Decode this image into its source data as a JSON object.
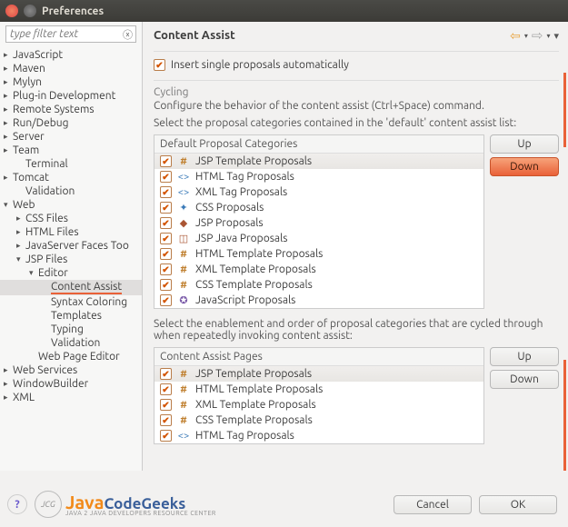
{
  "window": {
    "title": "Preferences"
  },
  "filter": {
    "placeholder": "type filter text"
  },
  "tree": [
    {
      "label": "JavaScript",
      "exp": "▸",
      "ind": 0
    },
    {
      "label": "Maven",
      "exp": "▸",
      "ind": 0
    },
    {
      "label": "Mylyn",
      "exp": "▸",
      "ind": 0
    },
    {
      "label": "Plug-in Development",
      "exp": "▸",
      "ind": 0
    },
    {
      "label": "Remote Systems",
      "exp": "▸",
      "ind": 0
    },
    {
      "label": "Run/Debug",
      "exp": "▸",
      "ind": 0
    },
    {
      "label": "Server",
      "exp": "▸",
      "ind": 0
    },
    {
      "label": "Team",
      "exp": "▸",
      "ind": 0
    },
    {
      "label": "Terminal",
      "exp": "",
      "ind": 1
    },
    {
      "label": "Tomcat",
      "exp": "▸",
      "ind": 0
    },
    {
      "label": "Validation",
      "exp": "",
      "ind": 1
    },
    {
      "label": "Web",
      "exp": "▾",
      "ind": 0
    },
    {
      "label": "CSS Files",
      "exp": "▸",
      "ind": 1
    },
    {
      "label": "HTML Files",
      "exp": "▸",
      "ind": 1
    },
    {
      "label": "JavaServer Faces Too",
      "exp": "▸",
      "ind": 1
    },
    {
      "label": "JSP Files",
      "exp": "▾",
      "ind": 1
    },
    {
      "label": "Editor",
      "exp": "▾",
      "ind": 2
    },
    {
      "label": "Content Assist",
      "exp": "",
      "ind": 3,
      "selected": true
    },
    {
      "label": "Syntax Coloring",
      "exp": "",
      "ind": 3
    },
    {
      "label": "Templates",
      "exp": "",
      "ind": 3
    },
    {
      "label": "Typing",
      "exp": "",
      "ind": 3
    },
    {
      "label": "Validation",
      "exp": "",
      "ind": 3
    },
    {
      "label": "Web Page Editor",
      "exp": "",
      "ind": 2
    },
    {
      "label": "Web Services",
      "exp": "▸",
      "ind": 0
    },
    {
      "label": "WindowBuilder",
      "exp": "▸",
      "ind": 0
    },
    {
      "label": "XML",
      "exp": "▸",
      "ind": 0
    }
  ],
  "content": {
    "title": "Content Assist",
    "insert_auto": "Insert single proposals automatically",
    "cycling_legend": "Cycling",
    "cycling_desc": "Configure the behavior of the content assist (Ctrl+Space) command.",
    "default_instr": "Select the proposal categories contained in the 'default' content assist list:",
    "default_header": "Default Proposal Categories",
    "proposals": [
      {
        "label": "JSP Template Proposals",
        "icon": "#",
        "cls": "hash",
        "sel": true
      },
      {
        "label": "HTML Tag Proposals",
        "icon": "<>",
        "cls": "tag"
      },
      {
        "label": "XML Tag Proposals",
        "icon": "<>",
        "cls": "tag"
      },
      {
        "label": "CSS Proposals",
        "icon": "✦",
        "cls": "css"
      },
      {
        "label": "JSP Proposals",
        "icon": "◆",
        "cls": "jsp"
      },
      {
        "label": "JSP Java Proposals",
        "icon": "◫",
        "cls": "jsp"
      },
      {
        "label": "HTML Template Proposals",
        "icon": "#",
        "cls": "hash"
      },
      {
        "label": "XML Template Proposals",
        "icon": "#",
        "cls": "hash"
      },
      {
        "label": "CSS Template Proposals",
        "icon": "#",
        "cls": "hash"
      },
      {
        "label": "JavaScript Proposals",
        "icon": "✪",
        "cls": "js"
      }
    ],
    "pages_instr": "Select the enablement and order of proposal categories that are cycled through when repeatedly invoking content assist:",
    "pages_header": "Content Assist Pages",
    "pages": [
      {
        "label": "JSP Template Proposals",
        "icon": "#",
        "cls": "hash",
        "sel": true
      },
      {
        "label": "HTML Template Proposals",
        "icon": "#",
        "cls": "hash"
      },
      {
        "label": "XML Template Proposals",
        "icon": "#",
        "cls": "hash"
      },
      {
        "label": "CSS Template Proposals",
        "icon": "#",
        "cls": "hash"
      },
      {
        "label": "HTML Tag Proposals",
        "icon": "<>",
        "cls": "tag"
      }
    ],
    "up": "Up",
    "down": "Down"
  },
  "footer": {
    "logo1": "Java",
    "logo2": "CodeGeeks",
    "tagline": "JAVA 2 JAVA DEVELOPERS RESOURCE CENTER",
    "cancel": "Cancel",
    "ok": "OK"
  }
}
